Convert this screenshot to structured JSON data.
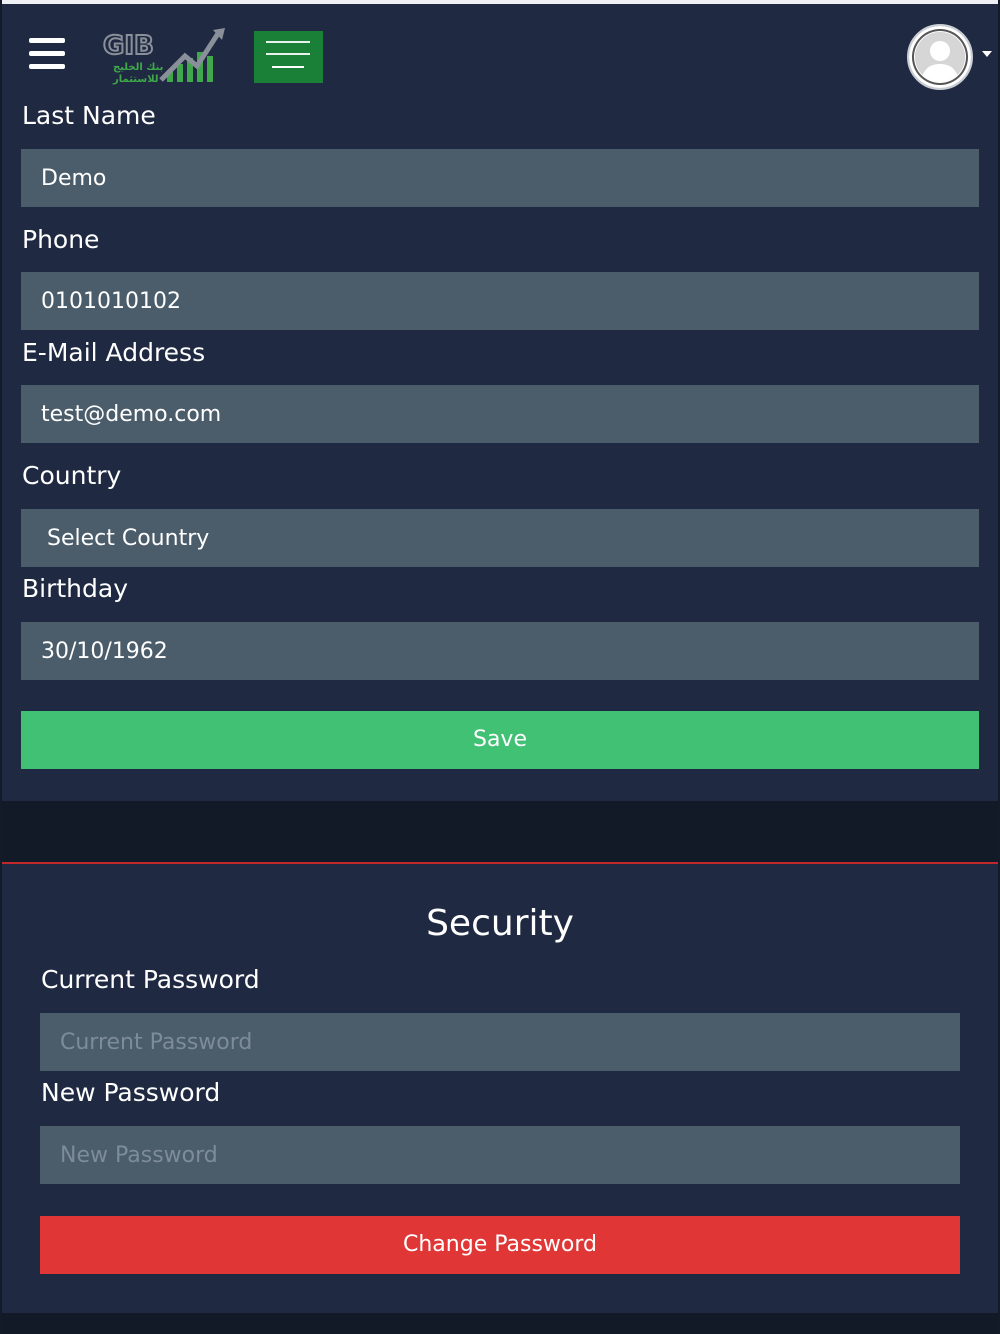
{
  "header": {
    "menu_icon": "hamburger-menu-icon",
    "logo": {
      "brand_text": "GIB",
      "arabic_text": "بنك الخليج للاستثمار"
    },
    "language_flag": "saudi-arabia-flag",
    "avatar_icon": "user-avatar-icon",
    "dropdown_icon": "caret-down-icon"
  },
  "profile_form": {
    "last_name": {
      "label": "Last Name",
      "value": "Demo"
    },
    "phone": {
      "label": "Phone",
      "value": "0101010102"
    },
    "email": {
      "label": "E-Mail Address",
      "value": "test@demo.com"
    },
    "country": {
      "label": "Country",
      "value": "Select Country"
    },
    "birthday": {
      "label": "Birthday",
      "value": "30/10/1962"
    },
    "save_label": "Save"
  },
  "security": {
    "title": "Security",
    "current_password": {
      "label": "Current Password",
      "placeholder": "Current Password"
    },
    "new_password": {
      "label": "New Password",
      "placeholder": "New Password"
    },
    "change_label": "Change Password"
  },
  "colors": {
    "background": "#1f2942",
    "field": "#4b5c6a",
    "save": "#40c174",
    "change_password": "#e03636",
    "divider": "#c0282b"
  }
}
